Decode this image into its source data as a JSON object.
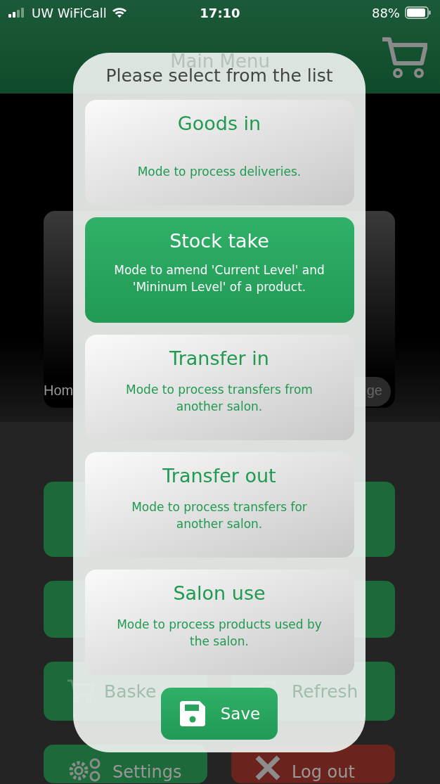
{
  "status_bar": {
    "carrier": "UW WiFiCall",
    "time": "17:10",
    "battery": "88%"
  },
  "header": {
    "title": "Main Menu"
  },
  "logo_card": {
    "left_tab": "Hom",
    "right_tab": "ge"
  },
  "menu_buttons": [
    {
      "label": "Baske",
      "kind": "basket",
      "color": "#1c6a39"
    },
    {
      "label": "Refresh",
      "kind": "refresh",
      "color": "#1c6a39"
    },
    {
      "label": "Settings",
      "kind": "settings",
      "color": "#1c6a39"
    },
    {
      "label": "Log out",
      "kind": "logout",
      "color": "#6a241d"
    }
  ],
  "dialog": {
    "title": "Please select from the list",
    "options": [
      {
        "title": "Goods in",
        "description": "Mode to process deliveries.",
        "selected": false
      },
      {
        "title": "Stock take",
        "description": "Mode to amend 'Current Level' and 'Mininum Level' of a product.",
        "selected": true
      },
      {
        "title": "Transfer in",
        "description": "Mode to process transfers from another salon.",
        "selected": false
      },
      {
        "title": "Transfer out",
        "description": "Mode to process transfers for another salon.",
        "selected": false
      },
      {
        "title": "Salon use",
        "description": "Mode to process products used by the salon.",
        "selected": false
      }
    ],
    "save_button": "Save"
  }
}
